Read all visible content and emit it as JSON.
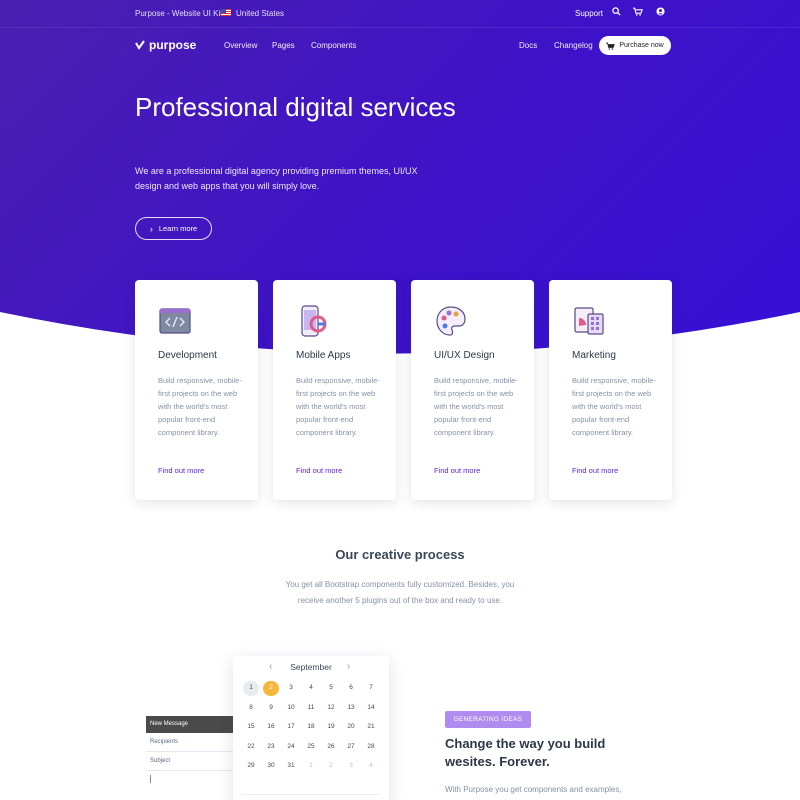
{
  "topbar": {
    "brand_line": "Purpose - Website UI Kit",
    "country": "United States",
    "support": "Support",
    "icons": [
      "search-icon",
      "cart-icon",
      "user-icon"
    ]
  },
  "navbar": {
    "logo_text": "purpose",
    "links": [
      "Overview",
      "Pages",
      "Components"
    ],
    "right_links": [
      "Docs",
      "Changelog"
    ],
    "purchase_label": "Purchase now"
  },
  "hero": {
    "title": "Professional digital services",
    "description": "We are a professional digital agency providing premium themes, UI/UX design and web apps that you will simply love.",
    "cta_label": "Learn more"
  },
  "cards": [
    {
      "icon": "code-window-icon",
      "title": "Development",
      "description": "Build responsive, mobile-first projects on the web with the world's most popular front-end component library.",
      "link": "Find out more"
    },
    {
      "icon": "mobile-apps-icon",
      "title": "Mobile Apps",
      "description": "Build responsive, mobile-first projects on the web with the world's most popular front-end component library.",
      "link": "Find out more"
    },
    {
      "icon": "palette-icon",
      "title": "UI/UX Design",
      "description": "Build responsive, mobile-first projects on the web with the world's most popular front-end component library.",
      "link": "Find out more"
    },
    {
      "icon": "marketing-chart-icon",
      "title": "Marketing",
      "description": "Build responsive, mobile-first projects on the web with the world's most popular front-end component library.",
      "link": "Find out more"
    }
  ],
  "process": {
    "title": "Our creative process",
    "description": "You get all Bootstrap components fully customized. Besides, you receive another 5 plugins out of the box and ready to use."
  },
  "message": {
    "header": "New Message",
    "recipients_placeholder": "Recipients",
    "subject_placeholder": "Subject"
  },
  "calendar": {
    "month": "September",
    "selected_day": "2",
    "today_day": "1",
    "days": [
      "1",
      "2",
      "3",
      "4",
      "5",
      "6",
      "7",
      "8",
      "9",
      "10",
      "11",
      "12",
      "13",
      "14",
      "15",
      "16",
      "17",
      "18",
      "19",
      "20",
      "21",
      "22",
      "23",
      "24",
      "25",
      "26",
      "27",
      "28",
      "29",
      "30",
      "31"
    ],
    "trailing_days": [
      "1",
      "2",
      "3",
      "4"
    ]
  },
  "feature": {
    "badge": "GENERATING IDEAS",
    "title": "Change the way you build wesites. Forever.",
    "description": "With Purpose you get components and examples,"
  },
  "colors": {
    "hero_start": "#4a1fb0",
    "hero_end": "#3510d6",
    "accent_link": "#5a1fd6",
    "selected_day": "#f6b73c",
    "badge": "#b08cf0"
  }
}
